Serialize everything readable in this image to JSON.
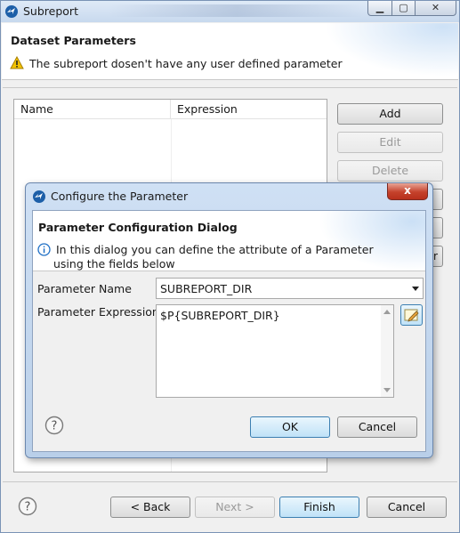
{
  "window": {
    "title": "Subreport",
    "app_icon": "jaspersoft-logo-icon",
    "controls": [
      "minimize-icon",
      "maximize-icon",
      "close-icon"
    ]
  },
  "header": {
    "title": "Dataset Parameters",
    "warning_icon": "warning-triangle-icon",
    "message": "The subreport dosen't have any user defined parameter"
  },
  "table": {
    "columns": [
      "Name",
      "Expression"
    ],
    "rows": []
  },
  "side_buttons": {
    "add": "Add",
    "edit": "Edit",
    "delete": "Delete",
    "partial_label": "r"
  },
  "footer": {
    "help_icon": "help-question-icon",
    "back": "< Back",
    "next": "Next >",
    "finish": "Finish",
    "cancel": "Cancel"
  },
  "dialog": {
    "title": "Configure the Parameter",
    "heading": "Parameter Configuration Dialog",
    "info_line1": "In this dialog you can define the attribute of a Parameter",
    "info_line2": "using the fields below",
    "name_label": "Parameter Name",
    "name_value": "SUBREPORT_DIR",
    "expression_label": "Parameter Expression",
    "expression_value": "$P{SUBREPORT_DIR}",
    "ok": "OK",
    "cancel": "Cancel",
    "close_glyph": "x"
  },
  "colors": {
    "default_button": "#bfe2f7",
    "dialog_frame": "#b9cfe9",
    "close_button": "#c5412b",
    "warning": "#f2c200",
    "info": "#1f6fc5"
  }
}
